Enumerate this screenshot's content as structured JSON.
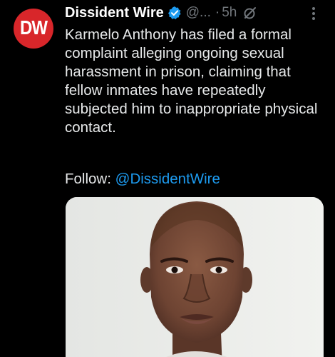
{
  "tweet": {
    "avatar_text": "DW",
    "display_name": "Dissident Wire",
    "handle": "@...",
    "separator": "·",
    "time": "5h",
    "text": "Karmelo Anthony has filed a formal complaint alleging ongoing sexual harassment in prison, claiming that fellow inmates have repeatedly subjected him to inappropriate physical contact.",
    "follow_label": "Follow: ",
    "follow_handle": "@DissidentWire"
  },
  "icons": {
    "verified": "verified-badge-icon",
    "grok": "grok-icon",
    "more": "more-options-icon"
  },
  "colors": {
    "background": "#000000",
    "text": "#e7e9ea",
    "muted": "#71767b",
    "link": "#1d9bf0",
    "avatar": "#d8262a"
  }
}
